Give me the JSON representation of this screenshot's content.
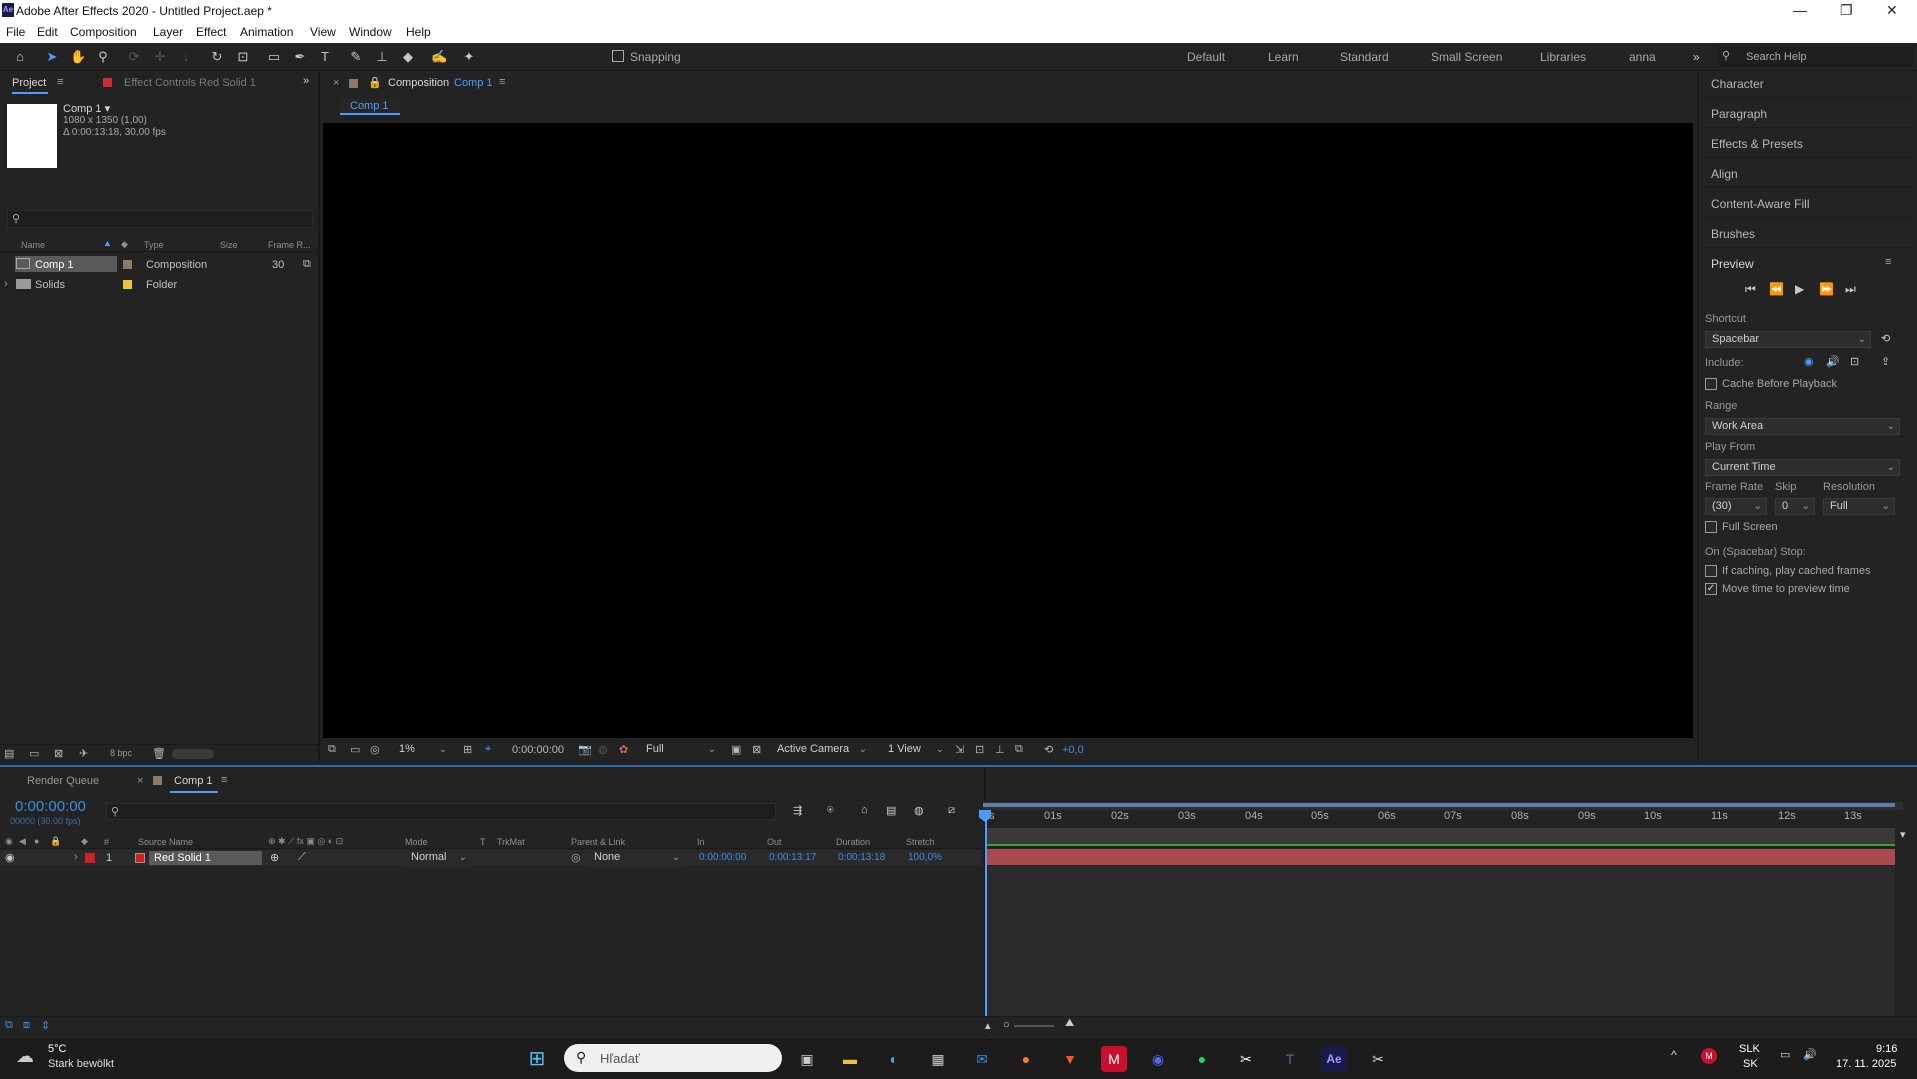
{
  "window": {
    "title": "Adobe After Effects 2020 - Untitled Project.aep *",
    "app_icon": "Ae",
    "minimize": "—",
    "maximize": "❐",
    "close": "✕"
  },
  "menu": [
    "File",
    "Edit",
    "Composition",
    "Layer",
    "Effect",
    "Animation",
    "View",
    "Window",
    "Help"
  ],
  "toolbar": {
    "snapping": "Snapping",
    "workspaces": [
      "Default",
      "Learn",
      "Standard",
      "Small Screen",
      "Libraries",
      "anna"
    ],
    "search_placeholder": "Search Help"
  },
  "project_panel": {
    "tab_project": "Project",
    "tab_effect_controls": "Effect Controls",
    "effect_controls_layer": "Red Solid 1",
    "comp_name": "Comp 1 ▾",
    "comp_size": "1080 x 1350 (1,00)",
    "comp_duration": "Δ 0:00:13:18, 30,00 fps",
    "columns": {
      "name": "Name",
      "type": "Type",
      "size": "Size",
      "frame_rate": "Frame R..."
    },
    "items": [
      {
        "name": "Comp 1",
        "type": "Composition",
        "frame_rate": "30",
        "label_color": "#8a7a6a"
      },
      {
        "name": "Solids",
        "type": "Folder",
        "frame_rate": "",
        "label_color": "#e8c63a"
      }
    ],
    "bpc": "8 bpc"
  },
  "composition_panel": {
    "tab_prefix": "Composition",
    "tab_comp": "Comp 1",
    "subtab": "Comp 1",
    "zoom": "1%",
    "timecode": "0:00:00:00",
    "resolution": "Full",
    "camera": "Active Camera",
    "views": "1 View",
    "exposure": "+0,0"
  },
  "right_panel": {
    "items": [
      "Character",
      "Paragraph",
      "Effects & Presets",
      "Align",
      "Content-Aware Fill",
      "Brushes"
    ],
    "preview": {
      "title": "Preview",
      "shortcut_label": "Shortcut",
      "shortcut": "Spacebar",
      "include_label": "Include:",
      "cache_before_playback": "Cache Before Playback",
      "range_label": "Range",
      "range": "Work Area",
      "play_from_label": "Play From",
      "play_from": "Current Time",
      "frame_rate_label": "Frame Rate",
      "skip_label": "Skip",
      "resolution_label": "Resolution",
      "frame_rate": "(30)",
      "skip": "0",
      "resolution": "Full",
      "full_screen": "Full Screen",
      "on_stop_label": "On (Spacebar) Stop:",
      "if_caching": "If caching, play cached frames",
      "move_time": "Move time to preview time",
      "move_time_checked": true
    }
  },
  "timeline": {
    "tab_render_queue": "Render Queue",
    "tab_comp": "Comp 1",
    "current_time": "0:00:00:00",
    "frames": "00000 (30.00 fps)",
    "columns": {
      "num": "#",
      "source_name": "Source Name",
      "mode": "Mode",
      "t": "T",
      "trkmat": "TrkMat",
      "parent": "Parent & Link",
      "in": "In",
      "out": "Out",
      "duration": "Duration",
      "stretch": "Stretch"
    },
    "layer": {
      "num": "1",
      "name": "Red Solid 1",
      "color": "#d02020",
      "mode": "Normal",
      "parent": "None",
      "in": "0:00:00:00",
      "out": "0:00:13:17",
      "duration": "0:00:13:18",
      "stretch": "100,0%"
    },
    "ticks": [
      "0s",
      "01s",
      "02s",
      "03s",
      "04s",
      "05s",
      "06s",
      "07s",
      "08s",
      "09s",
      "10s",
      "11s",
      "12s",
      "13s"
    ]
  },
  "taskbar": {
    "temp": "5°C",
    "weather": "Stark bewölkt",
    "search": "Hľadať",
    "lang1": "SLK",
    "lang2": "SK",
    "time": "9:16",
    "date": "17. 11. 2025"
  }
}
